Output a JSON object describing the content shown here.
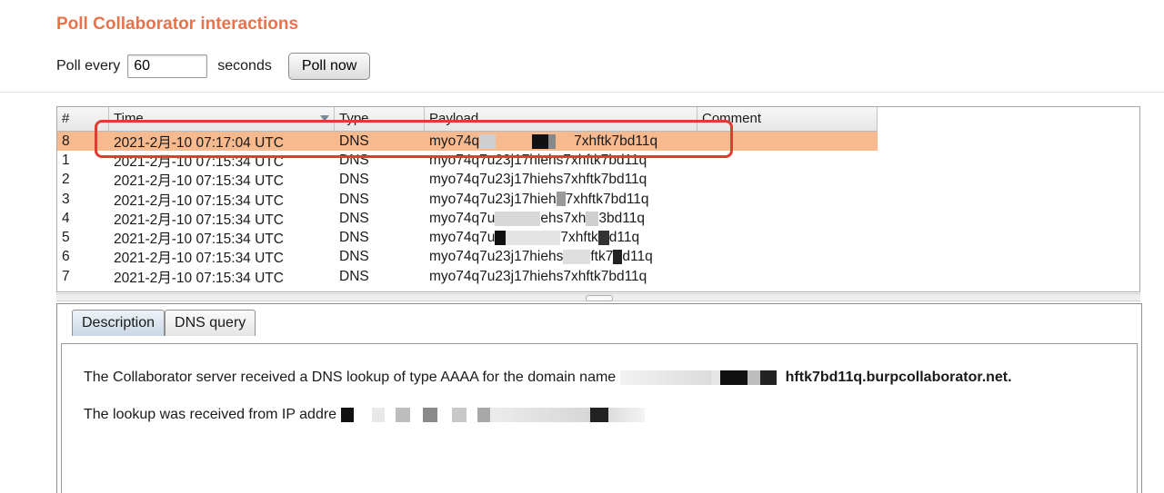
{
  "heading": "Poll Collaborator interactions",
  "poll": {
    "label": "Poll every",
    "value": "60",
    "unit": "seconds",
    "button": "Poll now"
  },
  "table": {
    "columns": [
      "#",
      "Time",
      "Type",
      "Payload",
      "Comment"
    ],
    "sort_icon": "sort-descending-icon",
    "rows": [
      {
        "num": "8",
        "time": "2021-2月-10 07:17:04 UTC",
        "type": "DNS",
        "payload": "myo74q",
        "payload_tail": "7xhftk7bd11q",
        "comment": ""
      },
      {
        "num": "1",
        "time": "2021-2月-10 07:15:34 UTC",
        "type": "DNS",
        "payload": "myo74q7u23j17hiehs7xhftk7bd11q",
        "comment": ""
      },
      {
        "num": "2",
        "time": "2021-2月-10 07:15:34 UTC",
        "type": "DNS",
        "payload": "myo74q7u23j17hiehs7xhftk7bd11q",
        "comment": ""
      },
      {
        "num": "3",
        "time": "2021-2月-10 07:15:34 UTC",
        "type": "DNS",
        "payload": "myo74q7u23j17hieh",
        "payload_tail": "7xhftk7bd11q",
        "comment": ""
      },
      {
        "num": "4",
        "time": "2021-2月-10 07:15:34 UTC",
        "type": "DNS",
        "payload": "myo74q7u",
        "payload_tail": "ehs7xh",
        "payload_tail2": "3bd11q",
        "comment": ""
      },
      {
        "num": "5",
        "time": "2021-2月-10 07:15:34 UTC",
        "type": "DNS",
        "payload": "myo74q7u",
        "payload_tail": "7xhftk",
        "payload_tail2": "d11q",
        "comment": ""
      },
      {
        "num": "6",
        "time": "2021-2月-10 07:15:34 UTC",
        "type": "DNS",
        "payload": "myo74q7u23j17hiehs",
        "payload_tail": "ftk7",
        "payload_tail2": "d11q",
        "comment": ""
      },
      {
        "num": "7",
        "time": "2021-2月-10 07:15:34 UTC",
        "type": "DNS",
        "payload": "myo74q7u23j17hiehs7xhftk7bd11q",
        "comment": ""
      }
    ],
    "selected_row": 0
  },
  "tabs": [
    "Description",
    "DNS query"
  ],
  "description": {
    "line1_prefix": "The Collaborator server received a DNS lookup of type AAAA for the domain name",
    "line1_suffix": "hftk7bd11q.burpcollaborator.net.",
    "line2_prefix": "The lookup was received from IP addre"
  },
  "colors": {
    "heading": "#e8734a",
    "selected_row": "#f7b98e",
    "annotation": "#e03c31"
  }
}
